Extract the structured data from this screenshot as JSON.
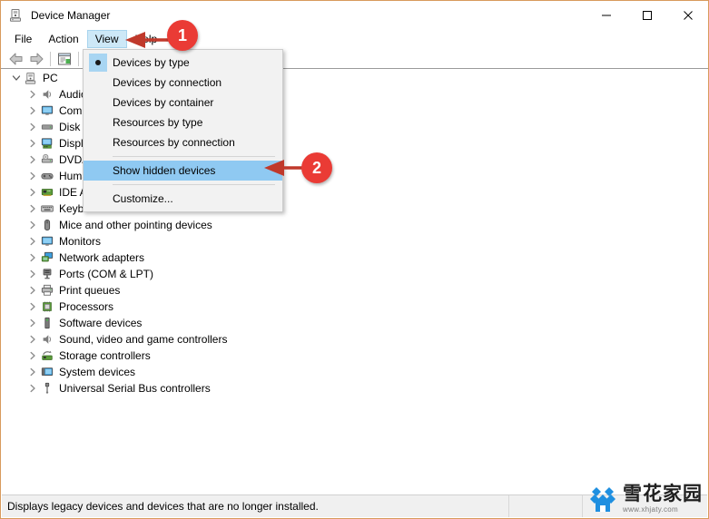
{
  "window": {
    "title": "Device Manager",
    "icon": "device-manager-icon",
    "controls": {
      "minimize": "—",
      "maximize": "□",
      "close": "✕"
    }
  },
  "menubar": {
    "items": [
      {
        "label": "File",
        "active": false
      },
      {
        "label": "Action",
        "active": false
      },
      {
        "label": "View",
        "active": true
      },
      {
        "label": "Help",
        "active": false
      }
    ]
  },
  "toolbar": {
    "buttons": [
      {
        "name": "back-button",
        "icon": "arrow-left-icon"
      },
      {
        "name": "forward-button",
        "icon": "arrow-right-icon"
      },
      {
        "name": "properties-button",
        "icon": "properties-icon"
      }
    ]
  },
  "view_menu": {
    "items": [
      {
        "label": "Devices by type",
        "radio": true,
        "selected": false,
        "separator_after": false
      },
      {
        "label": "Devices by connection",
        "radio": false,
        "selected": false,
        "separator_after": false
      },
      {
        "label": "Devices by container",
        "radio": false,
        "selected": false,
        "separator_after": false
      },
      {
        "label": "Resources by type",
        "radio": false,
        "selected": false,
        "separator_after": false
      },
      {
        "label": "Resources by connection",
        "radio": false,
        "selected": false,
        "separator_after": true
      },
      {
        "label": "Show hidden devices",
        "radio": false,
        "selected": true,
        "separator_after": true
      },
      {
        "label": "Customize...",
        "radio": false,
        "selected": false,
        "separator_after": false
      }
    ]
  },
  "tree": {
    "root": {
      "label": "PC",
      "icon": "computer-icon",
      "expanded": true
    },
    "items": [
      {
        "label": "Audio inputs and outputs",
        "icon": "speaker-icon"
      },
      {
        "label": "Computer",
        "icon": "monitor-icon"
      },
      {
        "label": "Disk drives",
        "icon": "disk-icon"
      },
      {
        "label": "Display adapters",
        "icon": "display-adapter-icon"
      },
      {
        "label": "DVD/CD-ROM drives",
        "icon": "dvd-icon"
      },
      {
        "label": "Human Interface Devices",
        "icon": "gamepad-icon"
      },
      {
        "label": "IDE ATA/ATAPI controllers",
        "icon": "controller-card-icon"
      },
      {
        "label": "Keyboards",
        "icon": "keyboard-icon"
      },
      {
        "label": "Mice and other pointing devices",
        "icon": "mouse-icon"
      },
      {
        "label": "Monitors",
        "icon": "monitor-icon"
      },
      {
        "label": "Network adapters",
        "icon": "network-icon"
      },
      {
        "label": "Ports (COM & LPT)",
        "icon": "port-icon"
      },
      {
        "label": "Print queues",
        "icon": "printer-icon"
      },
      {
        "label": "Processors",
        "icon": "cpu-icon"
      },
      {
        "label": "Software devices",
        "icon": "software-device-icon"
      },
      {
        "label": "Sound, video and game controllers",
        "icon": "speaker-icon"
      },
      {
        "label": "Storage controllers",
        "icon": "storage-controller-icon"
      },
      {
        "label": "System devices",
        "icon": "system-device-icon"
      },
      {
        "label": "Universal Serial Bus controllers",
        "icon": "usb-icon"
      }
    ]
  },
  "annotations": [
    {
      "number": "1",
      "target": "view-menu-button"
    },
    {
      "number": "2",
      "target": "show-hidden-devices-item"
    }
  ],
  "statusbar": {
    "message": "Displays legacy devices and devices that are no longer installed."
  },
  "watermark": {
    "name_zh": "雪花家园",
    "url": "www.xhjaty.com"
  },
  "colors": {
    "accent_red": "#ea3b35",
    "menu_highlight": "#8fc9f2",
    "active_menu": "#cde8f7",
    "window_border": "#d89a5c"
  }
}
